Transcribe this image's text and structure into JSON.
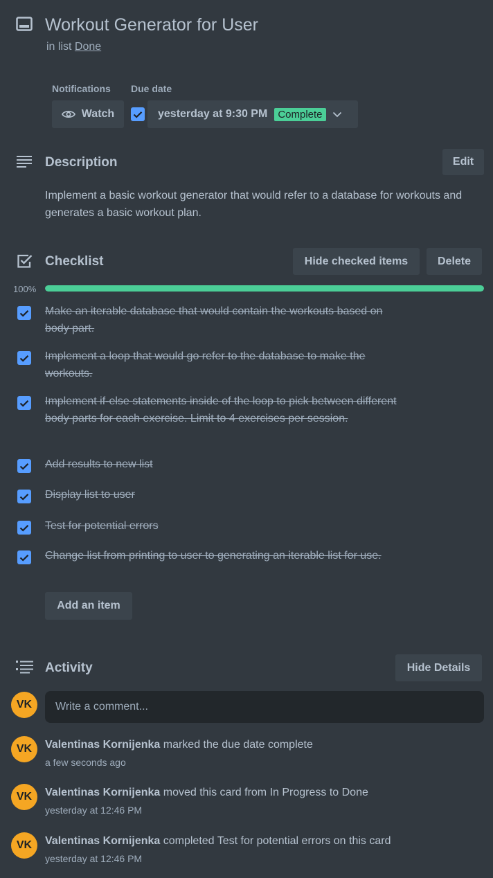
{
  "card": {
    "title": "Workout Generator for User",
    "list_prefix": "in list",
    "list_name": "Done"
  },
  "meta": {
    "notifications_label": "Notifications",
    "due_date_label": "Due date",
    "watch_label": "Watch",
    "due_value": "yesterday at 9:30 PM",
    "due_badge": "Complete"
  },
  "description": {
    "heading": "Description",
    "edit_label": "Edit",
    "text": "Implement a basic workout generator that would refer to a database for workouts and generates a basic workout plan."
  },
  "checklist": {
    "heading": "Checklist",
    "hide_checked_label": "Hide checked items",
    "delete_label": "Delete",
    "progress_text": "100%",
    "progress": 1.0,
    "items": [
      {
        "text": "Make an iterable database that would contain the workouts based on body part.",
        "checked": true
      },
      {
        "text": "Implement a loop that would go refer to the database to make the workouts.",
        "checked": true
      },
      {
        "text": "Implement if-else statements inside of the loop to pick between different body parts for each exercise. Limit to 4 exercises per session.",
        "checked": true
      },
      {
        "text": "Add results to new list",
        "checked": true
      },
      {
        "text": "Display list to user",
        "checked": true
      },
      {
        "text": "Test for potential errors",
        "checked": true
      },
      {
        "text": "Change list from printing to user to generating an iterable list for use.",
        "checked": true
      }
    ],
    "add_item_label": "Add an item"
  },
  "activity": {
    "heading": "Activity",
    "hide_details_label": "Hide Details",
    "comment_placeholder": "Write a comment...",
    "avatar_initials": "VK",
    "entries": [
      {
        "user": "Valentinas Kornijenka",
        "action": "marked the due date complete",
        "time": "a few seconds ago"
      },
      {
        "user": "Valentinas Kornijenka",
        "action": "moved this card from In Progress to Done",
        "time": "yesterday at 12:46 PM"
      },
      {
        "user": "Valentinas Kornijenka",
        "action": "completed Test for potential errors on this card",
        "time": "yesterday at 12:46 PM"
      }
    ]
  },
  "colors": {
    "background": "#323940",
    "progress": "#4bce97",
    "checkbox": "#579dff",
    "badge": "#4bce97",
    "avatar": "#f5a623"
  },
  "icons": [
    "card-icon",
    "eye-icon",
    "chevron-down-icon",
    "description-icon",
    "checklist-icon",
    "activity-icon",
    "check-icon"
  ]
}
